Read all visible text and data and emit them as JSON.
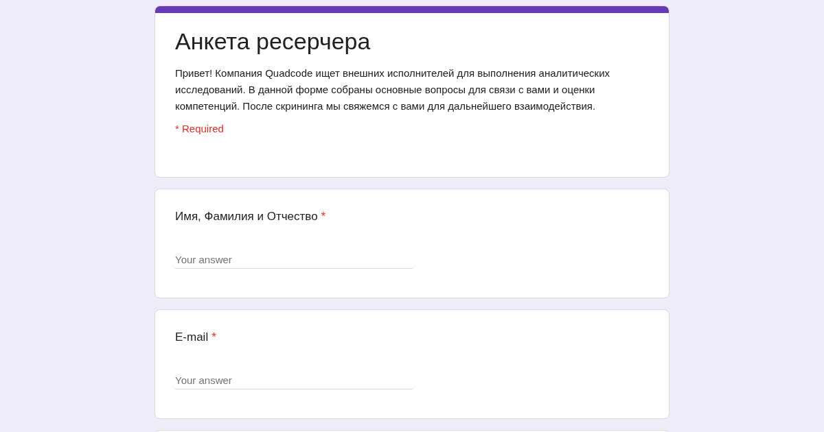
{
  "form": {
    "title": "Анкета ресерчера",
    "description": "Привет! Компания Quadcode ищет внешних исполнителей для выполнения аналитических исследований. В данной форме собраны основные вопросы для связи с вами и оценки компетенций. После скрининга мы свяжемся с вами для дальнейшего взаимодействия.",
    "required_note": "* Required"
  },
  "questions": [
    {
      "label": "Имя, Фамилия и Отчество",
      "required_mark": "*",
      "placeholder": "Your answer"
    },
    {
      "label": "E-mail",
      "required_mark": "*",
      "placeholder": "Your answer"
    }
  ]
}
